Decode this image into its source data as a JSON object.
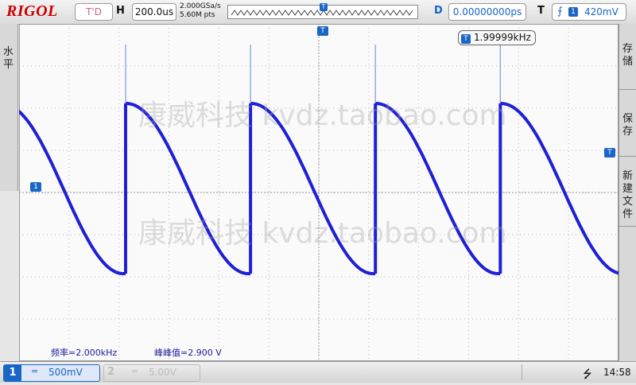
{
  "header": {
    "brand": "RIGOL",
    "run_status": "T'D",
    "h_label": "H",
    "timebase": "200.0us",
    "sample_rate": "2.000GSa/s",
    "memory_depth": "5.60M pts",
    "d_label": "D",
    "delay": "0.00000000ps",
    "t_label": "T",
    "trigger_source": "1",
    "trigger_level": "420mV"
  },
  "left_tab": {
    "label": "水平"
  },
  "right_menu": {
    "storage": "存储",
    "save": "保存",
    "new_file": "新建文件"
  },
  "watermark": "康威科技 kvdz.taobao.com",
  "frequency_badge": {
    "icon": "T",
    "value": "1.99999kHz"
  },
  "measurements": {
    "frequency": "频率=2.000kHz",
    "vpp": "峰峰值=2.900 V"
  },
  "channels": [
    {
      "num": "1",
      "coupling": "=",
      "scale": "500mV",
      "color": "#1a66c6",
      "active": true
    },
    {
      "num": "2",
      "coupling": "=",
      "scale": "5.00V",
      "color": "#bbbbbb",
      "active": false
    }
  ],
  "status_bar": {
    "time": "14:58",
    "usb_icon": "usb-icon"
  },
  "markers": {
    "ch1": "1",
    "trigger_level": "T",
    "trigger_position": "T"
  },
  "waveform": {
    "frequency_khz": 2.0,
    "vpp_v": 2.9,
    "color": "#1f1fd6"
  }
}
